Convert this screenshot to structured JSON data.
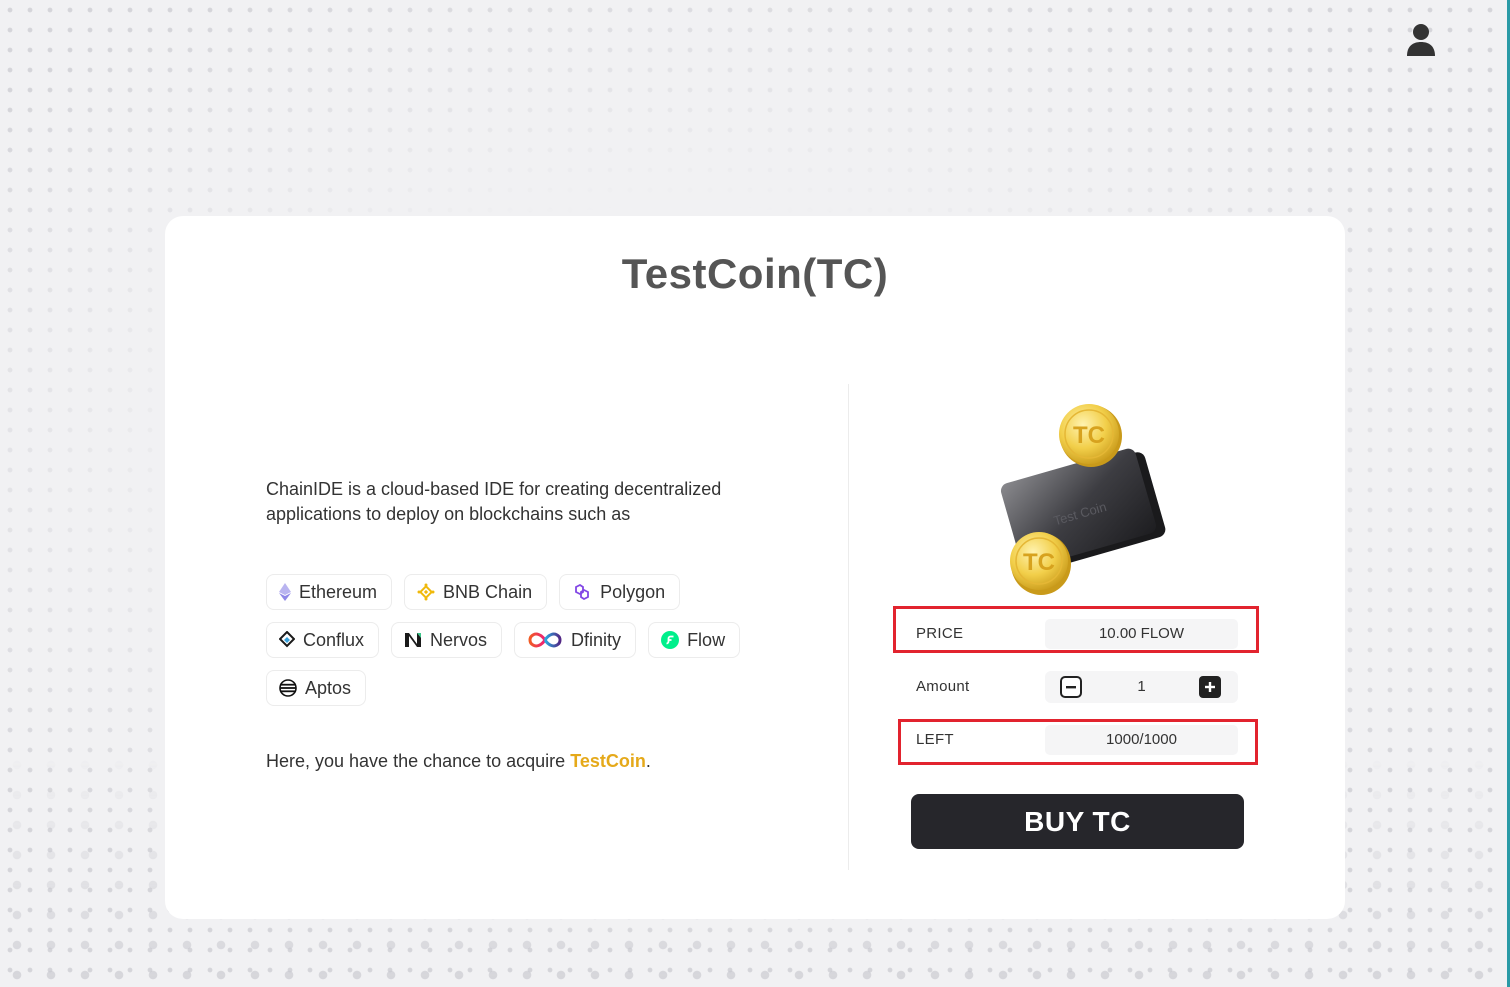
{
  "header": {
    "user_icon": "user-icon"
  },
  "card": {
    "title": "TestCoin(TC)",
    "intro": "ChainIDE is a cloud-based IDE for creating decentralized applications to deploy on blockchains such as",
    "chains": [
      {
        "label": "Ethereum",
        "icon": "ethereum-icon"
      },
      {
        "label": "BNB Chain",
        "icon": "bnb-chain-icon"
      },
      {
        "label": "Polygon",
        "icon": "polygon-icon"
      },
      {
        "label": "Conflux",
        "icon": "conflux-icon"
      },
      {
        "label": "Nervos",
        "icon": "nervos-icon"
      },
      {
        "label": "Dfinity",
        "icon": "dfinity-icon"
      },
      {
        "label": "Flow",
        "icon": "flow-icon"
      },
      {
        "label": "Aptos",
        "icon": "aptos-icon"
      }
    ],
    "acquire_prefix": "Here, you have the chance to acquire ",
    "acquire_token": "TestCoin",
    "acquire_suffix": ".",
    "coin_label": "TC",
    "wallet_label": "Test Coin"
  },
  "purchase": {
    "price_label": "PRICE",
    "price_value": "10.00 FLOW",
    "amount_label": "Amount",
    "amount_value": "1",
    "left_label": "LEFT",
    "left_value": "1000/1000",
    "buy_label": "BUY TC"
  },
  "colors": {
    "accent": "#e5a91a",
    "highlight": "#e2232e",
    "button_bg": "#26262b"
  }
}
